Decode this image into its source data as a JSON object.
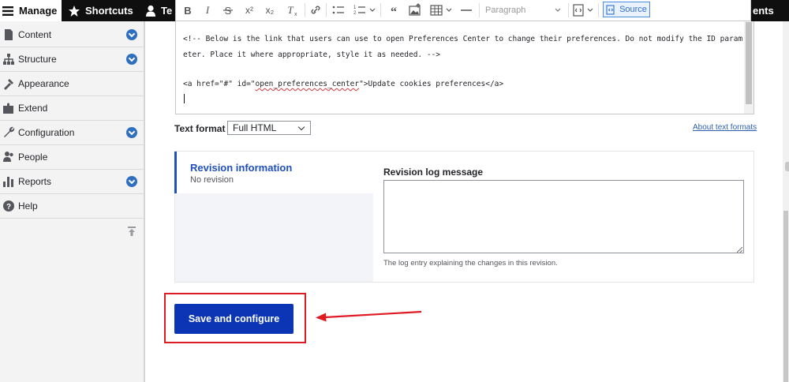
{
  "toolbar": {
    "manage_label": "Manage",
    "shortcuts_label": "Shortcuts",
    "user_label": "Te",
    "right_label": "ents"
  },
  "sidebar": {
    "items": [
      {
        "label": "Content",
        "icon": "content-icon",
        "expandable": true
      },
      {
        "label": "Structure",
        "icon": "structure-icon",
        "expandable": true
      },
      {
        "label": "Appearance",
        "icon": "appearance-icon",
        "expandable": false
      },
      {
        "label": "Extend",
        "icon": "extend-icon",
        "expandable": false
      },
      {
        "label": "Configuration",
        "icon": "wrench-icon",
        "expandable": true
      },
      {
        "label": "People",
        "icon": "people-icon",
        "expandable": false
      },
      {
        "label": "Reports",
        "icon": "reports-icon",
        "expandable": true
      },
      {
        "label": "Help",
        "icon": "help-icon",
        "expandable": false
      }
    ]
  },
  "editor": {
    "toolbar": {
      "bold": "B",
      "italic": "I",
      "superscript": "x²",
      "subscript": "x₂",
      "block_format": "Paragraph",
      "source_label": "Source"
    },
    "code_lines": [
      "<!-- Below is the link that users can use to open Preferences Center to change their preferences. Do not modify the ID param-",
      "eter. Place it where appropriate, style it as needed. -->",
      "<a href=\"#\" id=\"open_preferences_center\">Update cookies preferences</a>"
    ]
  },
  "text_format": {
    "label": "Text format",
    "selected": "Full HTML",
    "about_link": "About text formats"
  },
  "revision": {
    "title": "Revision information",
    "status": "No revision",
    "log_label": "Revision log message",
    "log_value": "",
    "log_help": "The log entry explaining the changes in this revision."
  },
  "actions": {
    "save_label": "Save and configure"
  },
  "colors": {
    "primary_button": "#0b35b5",
    "highlight": "#e01a22",
    "link": "#2e5fae",
    "toolbar_bg": "#0f0f0f"
  }
}
